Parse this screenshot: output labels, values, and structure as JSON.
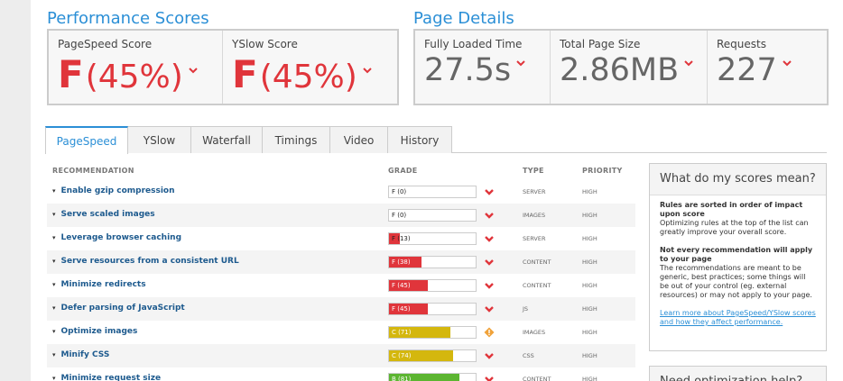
{
  "performance": {
    "title": "Performance Scores",
    "pagespeed": {
      "label": "PageSpeed Score",
      "grade": "F",
      "percent": "(45%)"
    },
    "yslow": {
      "label": "YSlow Score",
      "grade": "F",
      "percent": "(45%)"
    }
  },
  "page_details": {
    "title": "Page Details",
    "loaded": {
      "label": "Fully Loaded Time",
      "value": "27.5s"
    },
    "size": {
      "label": "Total Page Size",
      "value": "2.86MB"
    },
    "requests": {
      "label": "Requests",
      "value": "227"
    }
  },
  "tabs": [
    {
      "label": "PageSpeed",
      "active": true
    },
    {
      "label": "YSlow",
      "active": false
    },
    {
      "label": "Waterfall",
      "active": false
    },
    {
      "label": "Timings",
      "active": false
    },
    {
      "label": "Video",
      "active": false
    },
    {
      "label": "History",
      "active": false
    }
  ],
  "table": {
    "headers": {
      "recommendation": "RECOMMENDATION",
      "grade": "GRADE",
      "type": "TYPE",
      "priority": "PRIORITY"
    },
    "rows": [
      {
        "name": "Enable gzip compression",
        "grade": "F (0)",
        "score": 0,
        "type": "SERVER",
        "priority": "HIGH",
        "color": "#e0353b",
        "icon": "chevron-down-icon"
      },
      {
        "name": "Serve scaled images",
        "grade": "F (0)",
        "score": 0,
        "type": "IMAGES",
        "priority": "HIGH",
        "color": "#e0353b",
        "icon": "chevron-down-icon"
      },
      {
        "name": "Leverage browser caching",
        "grade": "F (13)",
        "score": 13,
        "type": "SERVER",
        "priority": "HIGH",
        "color": "#e0353b",
        "icon": "chevron-down-icon"
      },
      {
        "name": "Serve resources from a consistent URL",
        "grade": "F (38)",
        "score": 38,
        "type": "CONTENT",
        "priority": "HIGH",
        "color": "#e0353b",
        "icon": "chevron-down-icon"
      },
      {
        "name": "Minimize redirects",
        "grade": "F (45)",
        "score": 45,
        "type": "CONTENT",
        "priority": "HIGH",
        "color": "#e0353b",
        "icon": "chevron-down-icon"
      },
      {
        "name": "Defer parsing of JavaScript",
        "grade": "F (45)",
        "score": 45,
        "type": "JS",
        "priority": "HIGH",
        "color": "#e0353b",
        "icon": "chevron-down-icon"
      },
      {
        "name": "Optimize images",
        "grade": "C (71)",
        "score": 71,
        "type": "IMAGES",
        "priority": "HIGH",
        "color": "#d4b70e",
        "icon": "diamond-warning-icon"
      },
      {
        "name": "Minify CSS",
        "grade": "C (74)",
        "score": 74,
        "type": "CSS",
        "priority": "HIGH",
        "color": "#d4b70e",
        "icon": "chevron-down-icon"
      },
      {
        "name": "Minimize request size",
        "grade": "B (81)",
        "score": 81,
        "type": "CONTENT",
        "priority": "HIGH",
        "color": "#5cb531",
        "icon": "chevron-down-icon"
      }
    ]
  },
  "sidebar": {
    "title": "What do my scores mean?",
    "h1": "Rules are sorted in order of impact upon score",
    "p1": "Optimizing rules at the top of the list can greatly improve your overall score.",
    "h2": "Not every recommendation will apply to your page",
    "p2": "The recommendations are meant to be generic, best practices; some things will be out of your control (eg. external resources) or may not apply to your page.",
    "link": "Learn more about PageSpeed/YSlow scores and how they affect performance.",
    "next_title": "Need optimization help?"
  },
  "colors": {
    "accent": "#2b8fd6",
    "bad": "#e0353b",
    "warn": "#d4b70e",
    "good": "#5cb531"
  }
}
